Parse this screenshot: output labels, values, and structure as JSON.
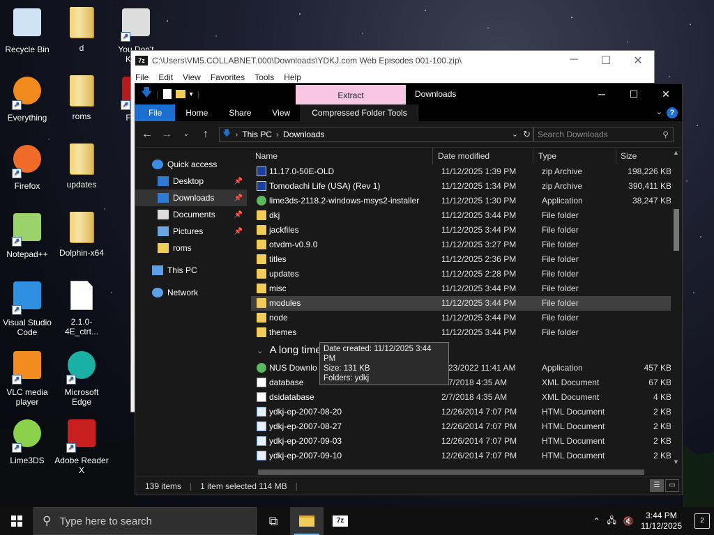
{
  "desktop_icons": [
    {
      "label": "Recycle Bin",
      "icon": "recycle-bin-icon"
    },
    {
      "label": "d",
      "icon": "folder-icon"
    },
    {
      "label": "You Don't Know",
      "icon": "game-shortcut-icon"
    },
    {
      "label": "Everything",
      "icon": "everything-search-icon"
    },
    {
      "label": "roms",
      "icon": "folder-icon"
    },
    {
      "label": "Flash",
      "icon": "flash-icon"
    },
    {
      "label": "Firefox",
      "icon": "firefox-icon"
    },
    {
      "label": "updates",
      "icon": "folder-icon"
    },
    {
      "label": "Notepad++",
      "icon": "notepadpp-icon"
    },
    {
      "label": "Dolphin-x64",
      "icon": "folder-icon"
    },
    {
      "label": "Visual Studio Code",
      "icon": "vscode-icon"
    },
    {
      "label": "2.1.0-4E_ctrt...",
      "icon": "file-icon"
    },
    {
      "label": "VLC media player",
      "icon": "vlc-icon"
    },
    {
      "label": "Microsoft Edge",
      "icon": "edge-icon"
    },
    {
      "label": "Lime3DS",
      "icon": "lime3ds-icon"
    },
    {
      "label": "Adobe Reader X",
      "icon": "adobe-reader-icon"
    }
  ],
  "zip_window": {
    "title": "C:\\Users\\VM5.COLLABNET.000\\Downloads\\YDKJ.com Web Episodes 001-100.zip\\",
    "logo": "7z",
    "menu": [
      "File",
      "Edit",
      "View",
      "Favorites",
      "Tools",
      "Help"
    ]
  },
  "explorer": {
    "title": "Downloads",
    "contextual_tab": "Extract",
    "ribbon_tabs": [
      "File",
      "Home",
      "Share",
      "View",
      "Compressed Folder Tools"
    ],
    "address": [
      "This PC",
      "Downloads"
    ],
    "search_placeholder": "Search Downloads",
    "nav": [
      {
        "label": "Quick access",
        "icon": "star-icon",
        "indent": 0
      },
      {
        "label": "Desktop",
        "icon": "desktop-folder-icon",
        "indent": 1,
        "pinned": true
      },
      {
        "label": "Downloads",
        "icon": "downloads-icon",
        "indent": 1,
        "pinned": true,
        "selected": true
      },
      {
        "label": "Documents",
        "icon": "documents-icon",
        "indent": 1,
        "pinned": true
      },
      {
        "label": "Pictures",
        "icon": "pictures-icon",
        "indent": 1,
        "pinned": true
      },
      {
        "label": "roms",
        "icon": "folder-icon",
        "indent": 1
      },
      {
        "label": "This PC",
        "icon": "pc-icon",
        "indent": 0
      },
      {
        "label": "Network",
        "icon": "network-icon",
        "indent": 0
      }
    ],
    "columns": [
      "Name",
      "Date modified",
      "Type",
      "Size"
    ],
    "rows_recent": [
      {
        "name": "11.17.0-50E-OLD",
        "date": "11/12/2025 1:39 PM",
        "type": "zip Archive",
        "size": "198,226 KB",
        "kind": "zip"
      },
      {
        "name": "Tomodachi Life (USA) (Rev 1)",
        "date": "11/12/2025 1:34 PM",
        "type": "zip Archive",
        "size": "390,411 KB",
        "kind": "zip"
      },
      {
        "name": "lime3ds-2118.2-windows-msys2-installer",
        "date": "11/12/2025 1:30 PM",
        "type": "Application",
        "size": "38,247 KB",
        "kind": "app"
      },
      {
        "name": "dkj",
        "date": "11/12/2025 3:44 PM",
        "type": "File folder",
        "size": "",
        "kind": "folder"
      },
      {
        "name": "jackfiles",
        "date": "11/12/2025 3:44 PM",
        "type": "File folder",
        "size": "",
        "kind": "folder"
      },
      {
        "name": "otvdm-v0.9.0",
        "date": "11/12/2025 3:27 PM",
        "type": "File folder",
        "size": "",
        "kind": "folder"
      },
      {
        "name": "titles",
        "date": "11/12/2025 2:36 PM",
        "type": "File folder",
        "size": "",
        "kind": "folder"
      },
      {
        "name": "updates",
        "date": "11/12/2025 2:28 PM",
        "type": "File folder",
        "size": "",
        "kind": "folder"
      },
      {
        "name": "misc",
        "date": "11/12/2025 3:44 PM",
        "type": "File folder",
        "size": "",
        "kind": "folder"
      },
      {
        "name": "modules",
        "date": "11/12/2025 3:44 PM",
        "type": "File folder",
        "size": "",
        "kind": "folder",
        "selected": true
      },
      {
        "name": "node",
        "date": "11/12/2025 3:44 PM",
        "type": "File folder",
        "size": "",
        "kind": "folder"
      },
      {
        "name": "themes",
        "date": "11/12/2025 3:44 PM",
        "type": "File folder",
        "size": "",
        "kind": "folder"
      }
    ],
    "group_header": "A long time",
    "rows_old": [
      {
        "name": "NUS Downlo",
        "date": "3/23/2022 11:41 AM",
        "type": "Application",
        "size": "457 KB",
        "kind": "app"
      },
      {
        "name": "database",
        "date": "2/7/2018 4:35 AM",
        "type": "XML Document",
        "size": "67 KB",
        "kind": "xml"
      },
      {
        "name": "dsidatabase",
        "date": "2/7/2018 4:35 AM",
        "type": "XML Document",
        "size": "4 KB",
        "kind": "xml"
      },
      {
        "name": "ydkj-ep-2007-08-20",
        "date": "12/26/2014 7:07 PM",
        "type": "HTML Document",
        "size": "2 KB",
        "kind": "html"
      },
      {
        "name": "ydkj-ep-2007-08-27",
        "date": "12/26/2014 7:07 PM",
        "type": "HTML Document",
        "size": "2 KB",
        "kind": "html"
      },
      {
        "name": "ydkj-ep-2007-09-03",
        "date": "12/26/2014 7:07 PM",
        "type": "HTML Document",
        "size": "2 KB",
        "kind": "html"
      },
      {
        "name": "ydkj-ep-2007-09-10",
        "date": "12/26/2014 7:07 PM",
        "type": "HTML Document",
        "size": "2 KB",
        "kind": "html"
      }
    ],
    "tooltip": [
      "Date created: 11/12/2025 3:44 PM",
      "Size: 131 KB",
      "Folders: ydkj"
    ],
    "status": {
      "items": "139 items",
      "selected": "1 item selected  114 MB"
    }
  },
  "taskbar": {
    "search_placeholder": "Type here to search",
    "time": "3:44 PM",
    "date": "11/12/2025",
    "notifications": "2"
  },
  "colors": {
    "accent": "#1a6fd1",
    "extract_tab": "#f7c6e0",
    "folder": "#f2cc58"
  }
}
